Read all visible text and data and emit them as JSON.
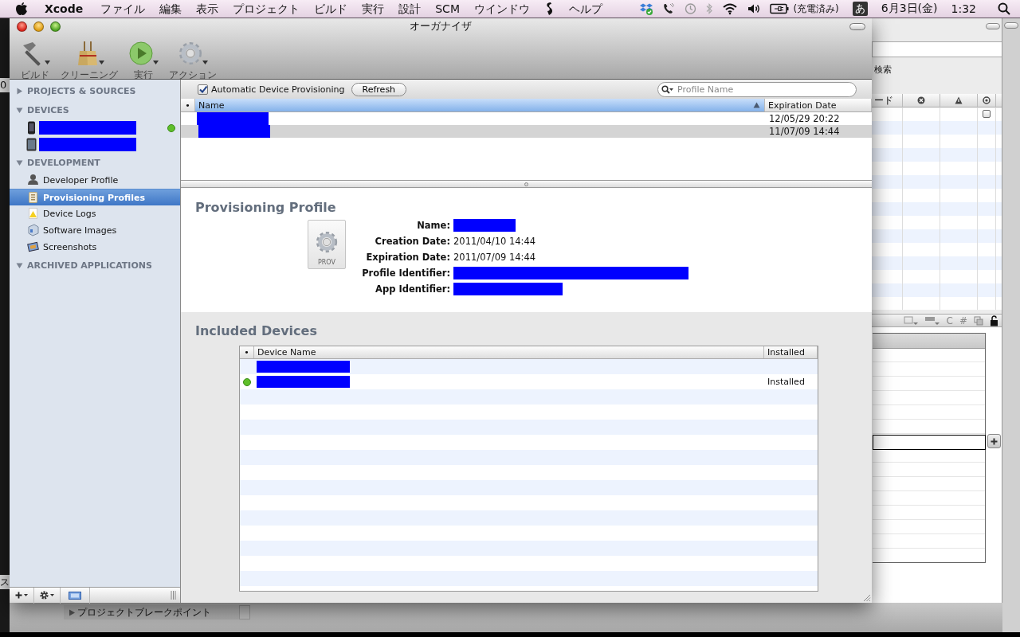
{
  "menubar": {
    "app": "Xcode",
    "menus": [
      "ファイル",
      "編集",
      "表示",
      "プロジェクト",
      "ビルド",
      "実行",
      "設計",
      "SCM",
      "ウインドウ",
      "ヘルプ"
    ],
    "battery_status": "(充電済み)",
    "input_mode": "あ",
    "date": "6月3日(金)",
    "time": "1:32"
  },
  "background_window": {
    "search_label": "検索",
    "column_1": "ード",
    "row_checkbox": {
      "checked": false
    },
    "toolbar_glyphs": [
      "C",
      "#"
    ],
    "breakpoints_label": "プロジェクトブレークポイント",
    "edge_texts": [
      "0",
      "ス"
    ]
  },
  "organizer": {
    "title": "オーガナイザ",
    "toolbar": [
      {
        "label": "ビルド"
      },
      {
        "label": "クリーニング"
      },
      {
        "label": "実行"
      },
      {
        "label": "アクション"
      }
    ],
    "sidebar": {
      "sections": [
        {
          "label": "PROJECTS & SOURCES",
          "expanded": false
        },
        {
          "label": "DEVICES",
          "expanded": true,
          "items": [
            {
              "kind": "phone",
              "redacted": true,
              "connected": true,
              "selected": false
            },
            {
              "kind": "tablet",
              "redacted": true,
              "connected": false,
              "selected": false
            }
          ]
        },
        {
          "label": "DEVELOPMENT",
          "expanded": true,
          "items": [
            {
              "kind": "tool",
              "label": "Developer Profile",
              "selected": false
            },
            {
              "kind": "tool",
              "label": "Provisioning Profiles",
              "selected": true
            },
            {
              "kind": "tool",
              "label": "Device Logs",
              "selected": false
            },
            {
              "kind": "tool",
              "label": "Software Images",
              "selected": false
            },
            {
              "kind": "tool",
              "label": "Screenshots",
              "selected": false
            }
          ]
        },
        {
          "label": "ARCHIVED APPLICATIONS",
          "expanded": true
        }
      ]
    },
    "profiles": {
      "auto_provisioning": {
        "label": "Automatic Device Provisioning",
        "checked": true
      },
      "refresh_button": "Refresh",
      "search": {
        "placeholder": "Profile Name"
      },
      "columns": [
        {
          "label": "•",
          "sorted": false
        },
        {
          "label": "Name",
          "sorted": true
        },
        {
          "label": "Expiration Date",
          "sorted": false
        }
      ],
      "rows": [
        {
          "name_redacted": true,
          "expiration": "12/05/29 20:22",
          "selected": false
        },
        {
          "name_redacted": true,
          "expiration": "11/07/09 14:44",
          "selected": true
        }
      ]
    },
    "profile_detail": {
      "heading": "Provisioning Profile",
      "icon_label": "PROV",
      "fields": [
        {
          "label": "Name:",
          "redacted": true
        },
        {
          "label": "Creation Date:",
          "value": "2011/04/10 14:44",
          "redacted": false
        },
        {
          "label": "Expiration Date:",
          "value": "2011/07/09 14:44",
          "redacted": false
        },
        {
          "label": "Profile Identifier:",
          "redacted": true
        },
        {
          "label": "App Identifier:",
          "redacted": true
        }
      ]
    },
    "included_devices": {
      "heading": "Included Devices",
      "columns": [
        "•",
        "Device Name",
        "Installed"
      ],
      "rows": [
        {
          "name_redacted": true,
          "connected": false
        },
        {
          "name_redacted": true,
          "connected": true,
          "installed": "Installed"
        }
      ]
    }
  }
}
